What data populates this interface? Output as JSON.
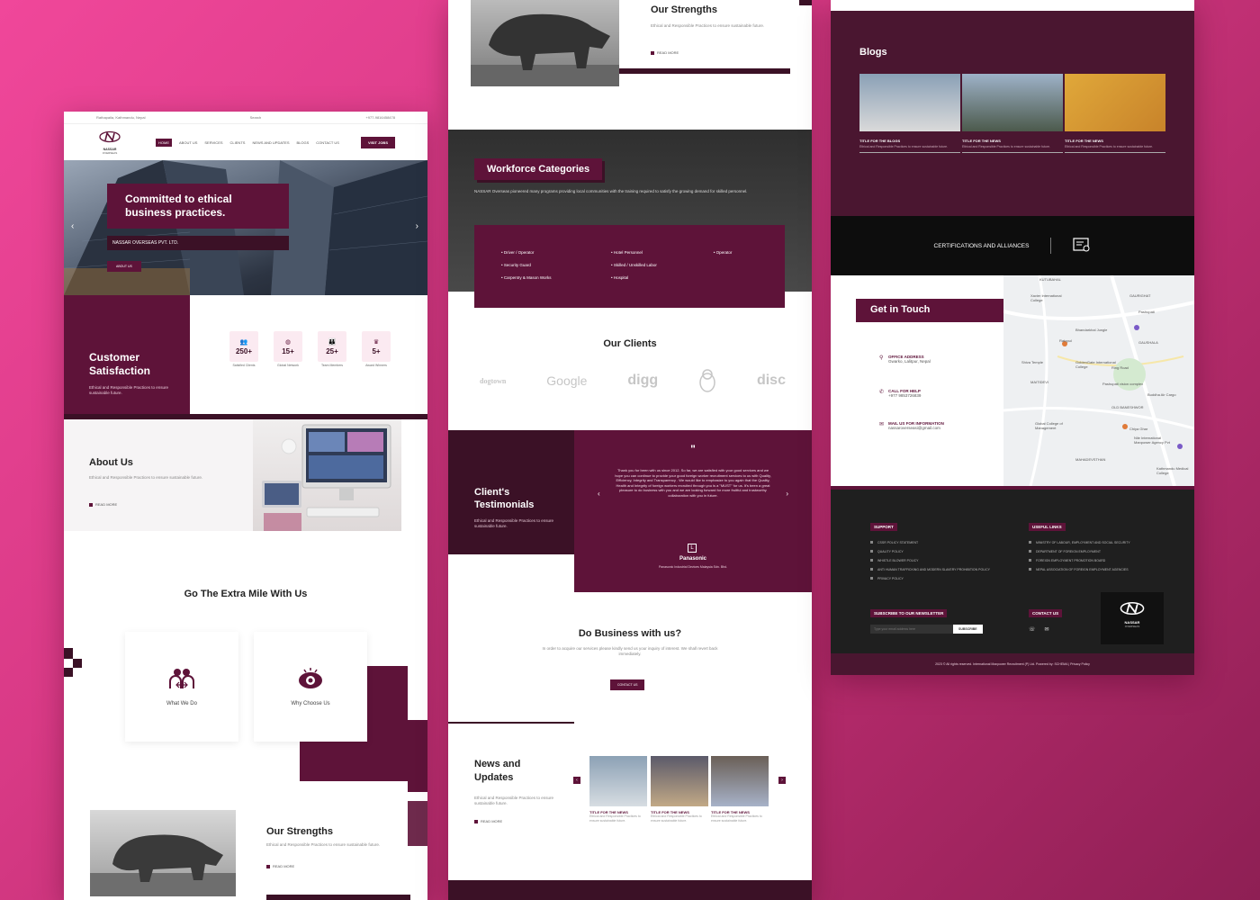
{
  "brand": {
    "name": "NASSAR",
    "sub": "OVERSEAS",
    "accent": "#5e1339",
    "dark": "#3b1126"
  },
  "topbar": {
    "location": "Rathapaila, Kathmandu, Nepal",
    "search": "Search",
    "phone": "+977-9816458478"
  },
  "nav": {
    "items": [
      "HOME",
      "ABOUT US",
      "SERVICES",
      "CLIENTS",
      "NEWS AND UPDATES",
      "BLOGS",
      "CONTACT US"
    ],
    "cta": "VISIT JOBS"
  },
  "hero": {
    "title": "Committed to ethical business practices.",
    "company": "NASSAR OVERSEAS PVT. LTD.",
    "button": "ABOUT US"
  },
  "satisfaction": {
    "title": "Customer Satisfaction",
    "desc": "Ethical and Responsible Practices to ensure sustainable future.",
    "stats": [
      {
        "icon": "people-icon",
        "value": "250+",
        "label": "Satisfied Clients"
      },
      {
        "icon": "globe-icon",
        "value": "15+",
        "label": "Global Network"
      },
      {
        "icon": "team-icon",
        "value": "25+",
        "label": "Team Members"
      },
      {
        "icon": "award-icon",
        "value": "5+",
        "label": "Award Winners"
      }
    ]
  },
  "about": {
    "title": "About Us",
    "desc": "Ethical and Responsible Practices to ensure sustainable future.",
    "read_more": "READ MORE"
  },
  "extra": {
    "title": "Go The Extra Mile With Us",
    "cards": [
      "What We Do",
      "Why Choose Us"
    ]
  },
  "strengths": {
    "title": "Our Strengths",
    "desc": "Ethical and Responsible Practices to ensure sustainable future.",
    "read_more": "READ MORE"
  },
  "workforce": {
    "title": "Workforce Categories",
    "desc": "NASSAR Overseas pioneered many programs providing local communities with the training required to satisfy the growing demand for skilled personnel.",
    "col1": [
      "Driver / Operator",
      "Security Guard",
      "Carpentry & Mason Works"
    ],
    "col2": [
      "Hotel Personnel",
      "Skilled / Unskilled Labor",
      "Hospital"
    ],
    "col3": [
      "Operator"
    ]
  },
  "clients": {
    "title": "Our Clients",
    "logos": [
      "dogtown",
      "Google",
      "digg",
      "linux",
      "disc"
    ]
  },
  "testimonials": {
    "title": "Client's Testimonials",
    "desc": "Ethical and Responsible Practices to ensure sustainable future.",
    "quote": "Thank you for been with us since 2012. So far, we are satisfied with your good services and we hope you can continue to provide your good foreign worker recruitment services to us with Quality, Efficiency, Integrity and Transparency . We would like to emphasize to you again that the Quality, Health and Integrity of foreign workers recruited through you is a \"MUST\" for us. It's been a great pleasure to do business with you and we are looking forward for more fruitful and trustworthy collaboration with you in future.",
    "company": "Panasonic",
    "company_full": "Panasonic Industrial Devices Malaysia Sdn. Bhd."
  },
  "business": {
    "title": "Do Business with us?",
    "desc": "In order to acquire our services please kindly send us your inquiry of interest. We shall revert back immediately.",
    "button": "CONTACT US"
  },
  "news": {
    "title": "News and Updates",
    "desc": "Ethical and Responsible Practices to ensure sustainable future.",
    "read_more": "READ MORE",
    "items": [
      {
        "title": "TITLE FOR THE NEWS",
        "desc": "Ethical and Responsible Practices to ensure sustainable future."
      },
      {
        "title": "TITLE FOR THE NEWS",
        "desc": "Ethical and Responsible Practices to ensure sustainable future."
      },
      {
        "title": "TITLE FOR THE NEWS",
        "desc": "Ethical and Responsible Practices to ensure sustainable future."
      }
    ]
  },
  "blogs": {
    "title": "Blogs",
    "items": [
      {
        "title": "TITLE FOR THE BLOGS",
        "desc": "Ethical and Responsible Practices to ensure sustainable future."
      },
      {
        "title": "TITLE FOR THE NEWS",
        "desc": "Ethical and Responsible Practices to ensure sustainable future."
      },
      {
        "title": "TITLE FOR THE NEWS",
        "desc": "Ethical and Responsible Practices to ensure sustainable future."
      }
    ]
  },
  "certs": {
    "title": "CERTIFICATIONS AND ALLIANCES"
  },
  "contact": {
    "title": "Get in Touch",
    "office_label": "OFFICE ADDRESS",
    "office": "Gwarko, Lalitpur, Nepal",
    "call_label": "CALL FOR HELP",
    "call": "+977 9853726839",
    "mail_label": "MAIL US FOR INFORMATION",
    "mail": "nassaroverseasi@gmail.com"
  },
  "map": {
    "labels": [
      "KUTUBAHAL",
      "Xavier International College",
      "GAURIGHAT",
      "Pashupati",
      "Bhandarkhal Jungle",
      "GAUSHALA",
      "Ratopul",
      "Shiva Temple",
      "GoldenGate International College",
      "Ring Road",
      "MAITIDEVI",
      "Pashupati vision complex",
      "OLD BANESHWOR",
      "Buddha Air Cargo",
      "Global College of Management",
      "Chiya Ghar",
      "MAHADEVSTHAN",
      "Kathmandu Medical College",
      "Nile International Manpower Agency Pvt"
    ]
  },
  "footer": {
    "support_title": "SUPPORT",
    "support": [
      "CSSR POLICY STATEMENT",
      "QUALITY POLICY",
      "WHISTLE BLOWER POLICY",
      "ANTI HUMAN TRAFFICKING AND MODERN SLAVERY PROHIBITION POLICY",
      "PRIVACY POLICY"
    ],
    "links_title": "USEFUL LINKS",
    "links": [
      "MINISTRY OF LABOUR, EMPLOYMENT AND SOCIAL SECURITY",
      "DEPARTMENT OF FOREIGN EMPLOYMENT",
      "FOREIGN EMPLOYMENT PROMOTION BOARD",
      "NEPAL ASSOCIATION OF FOREIGN EMPLOYMENT AGENCIES"
    ],
    "newsletter_title": "SUBSCRIBE TO OUR NEWSLETTER",
    "newsletter_placeholder": "Type your email address here",
    "subscribe": "SUBSCRIBE",
    "contact_title": "CONTACT US",
    "copyright": "2023 © All rights reserved. International Manpower Recruitment (P) Ltd. Powered by: SCHEMA | Privacy Policy"
  }
}
